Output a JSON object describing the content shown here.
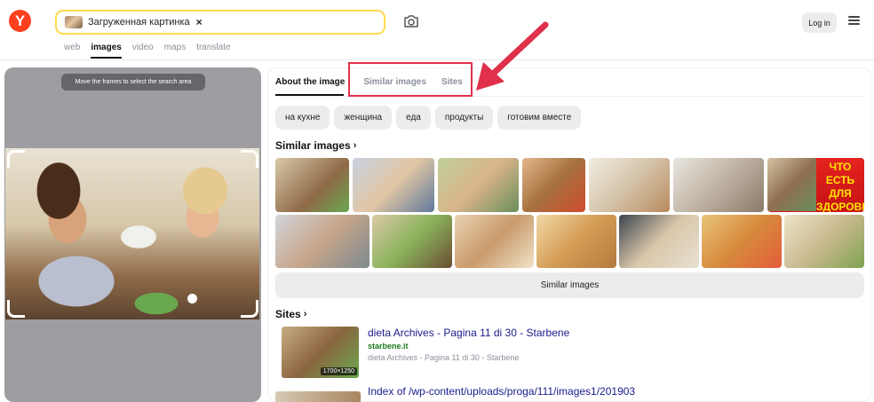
{
  "header": {
    "logo_letter": "Y",
    "search_chip_label": "Загруженная картинка",
    "chip_close": "×",
    "login_label": "Log in"
  },
  "nav_tabs": [
    {
      "label": "web",
      "active": false
    },
    {
      "label": "images",
      "active": true
    },
    {
      "label": "video",
      "active": false
    },
    {
      "label": "maps",
      "active": false
    },
    {
      "label": "translate",
      "active": false
    }
  ],
  "left_panel": {
    "hint": "Move the frames to select the search area"
  },
  "result_tabs": [
    {
      "label": "About the image",
      "active": true
    },
    {
      "label": "Similar images",
      "active": false
    },
    {
      "label": "Sites",
      "active": false
    }
  ],
  "tags": [
    "на кухне",
    "женщина",
    "еда",
    "продукты",
    "готовим вместе"
  ],
  "similar": {
    "title": "Similar images",
    "chevron": "›",
    "promo_text": "ЧТО ЕСТЬ ДЛЯ ЗДОРОВЬЯ",
    "button_label": "Similar images"
  },
  "sites": {
    "title": "Sites",
    "chevron": "›",
    "items": [
      {
        "title": "dieta Archives - Pagina 11 di 30 - Starbene",
        "host": "starbene.it",
        "description": "dieta Archives - Pagina 11 di 30 - Starbene",
        "dimensions": "1700×1250"
      },
      {
        "title": "Index of /wp-content/uploads/proga/111/images1/201903"
      }
    ]
  },
  "colors": {
    "brand": "#fc3f1d",
    "search_border": "#ffdb4d",
    "highlight": "#e0304b",
    "link": "#1a1a8c",
    "host": "#1b7a1b"
  },
  "icons": [
    "camera-icon",
    "menu-icon",
    "close-icon",
    "chevron-right-icon",
    "red-arrow"
  ]
}
